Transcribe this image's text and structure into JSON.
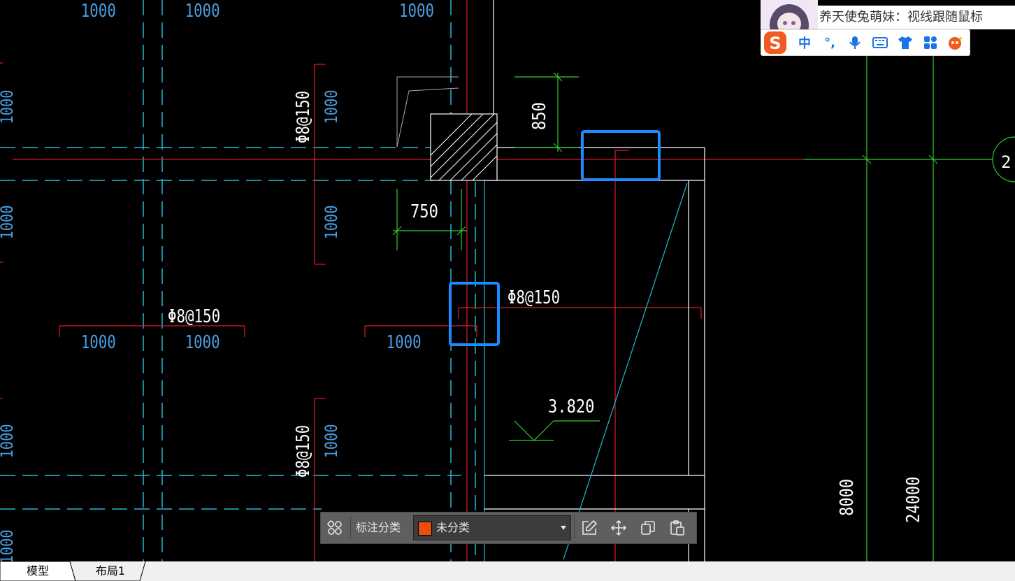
{
  "drawing": {
    "dimensions": {
      "top_row": [
        "1000",
        "1000",
        "1000"
      ],
      "left_vertical": [
        "1000",
        "1000",
        "1000",
        "1000"
      ],
      "mid_vertical": [
        "1000",
        "1000",
        "1000"
      ],
      "mid_row": [
        "1000",
        "1000",
        "1000"
      ],
      "dim_850": "850",
      "dim_750": "750",
      "dim_8000": "8000",
      "dim_24000": "24000",
      "elevation": "3.820",
      "grid_bubble": "2"
    },
    "rebar_labels": {
      "upper_vertical": "Φ8@150",
      "lower_vertical": "Φ8@150",
      "left_horizontal": "Φ8@150",
      "right_horizontal": "Φ8@150"
    },
    "colors": {
      "background": "#000000",
      "dim_text": "#4a9de0",
      "rebar_line": "#c8102e",
      "axis_red": "#e01a2a",
      "green": "#2ecc2e",
      "cyan": "#27b8d6",
      "white": "#ffffff",
      "highlight": "#1a8cff"
    }
  },
  "ime": {
    "title": "养天使兔萌妹：视线跟随鼠标",
    "buttons": [
      "中",
      "°,",
      "mic-icon",
      "keyboard-icon",
      "shirt-icon",
      "apps-icon",
      "mascot-icon"
    ]
  },
  "toolbar": {
    "label": "标注分类",
    "selected_category": "未分类",
    "swatch_color": "#e84e0e"
  },
  "tabs": [
    {
      "label": "模型",
      "active": true
    },
    {
      "label": "布局1",
      "active": false
    }
  ]
}
